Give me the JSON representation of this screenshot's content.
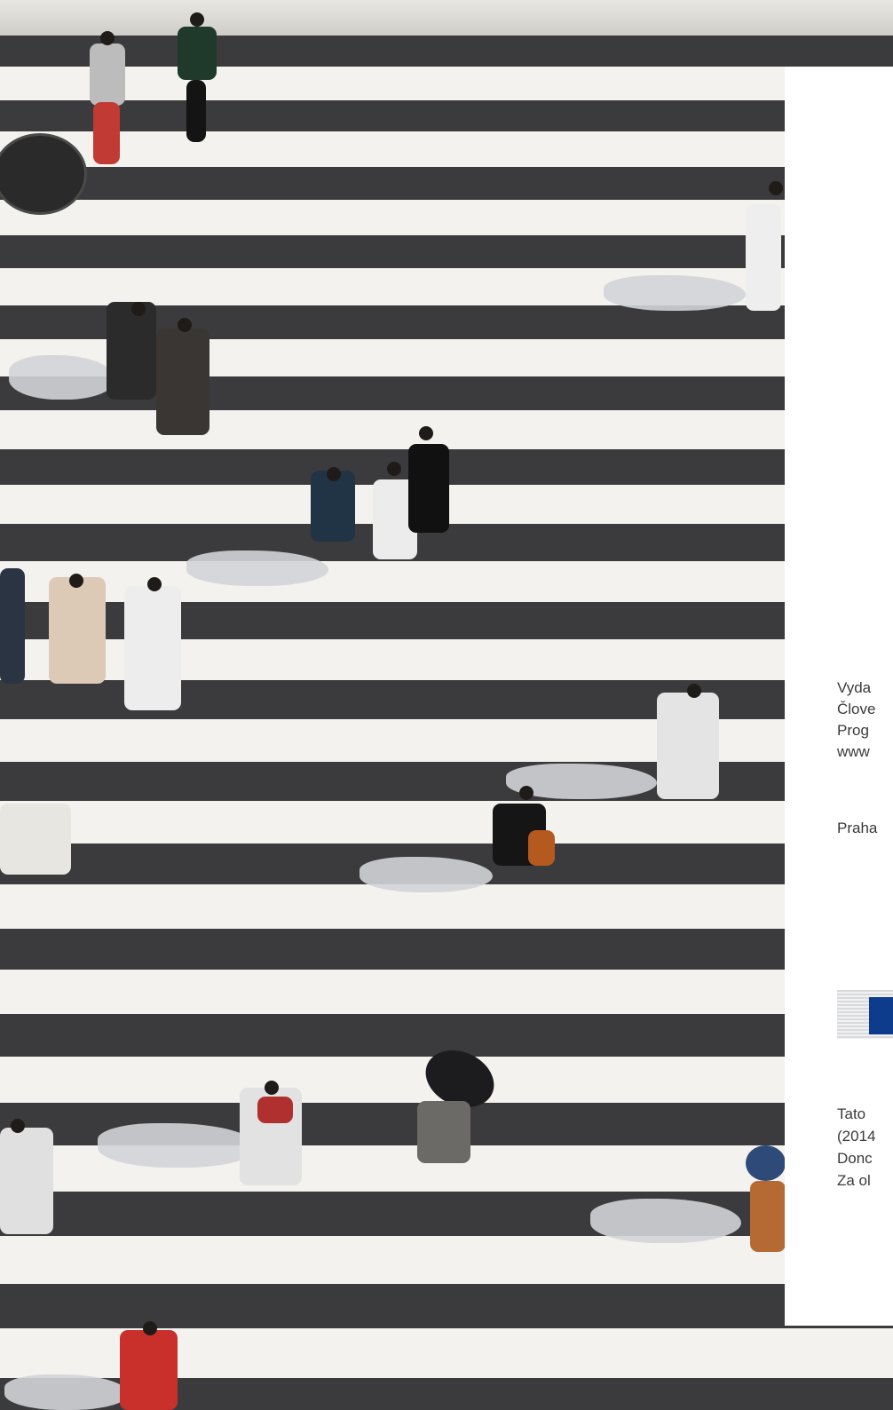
{
  "colophon": {
    "lines_1": [
      "Vyda",
      "Člove",
      "Prog",
      "www"
    ],
    "place": "Praha",
    "lines_2": [
      "Tato",
      "(2014",
      "Donc",
      "Za ol"
    ]
  },
  "logo": {
    "name": "eu-logo",
    "flag_color": "#0e3c8c"
  },
  "photo": {
    "subject": "pedestrian-crossing",
    "stripe_color": "#f3f2ef",
    "asphalt_color": "#3b3b3d"
  }
}
